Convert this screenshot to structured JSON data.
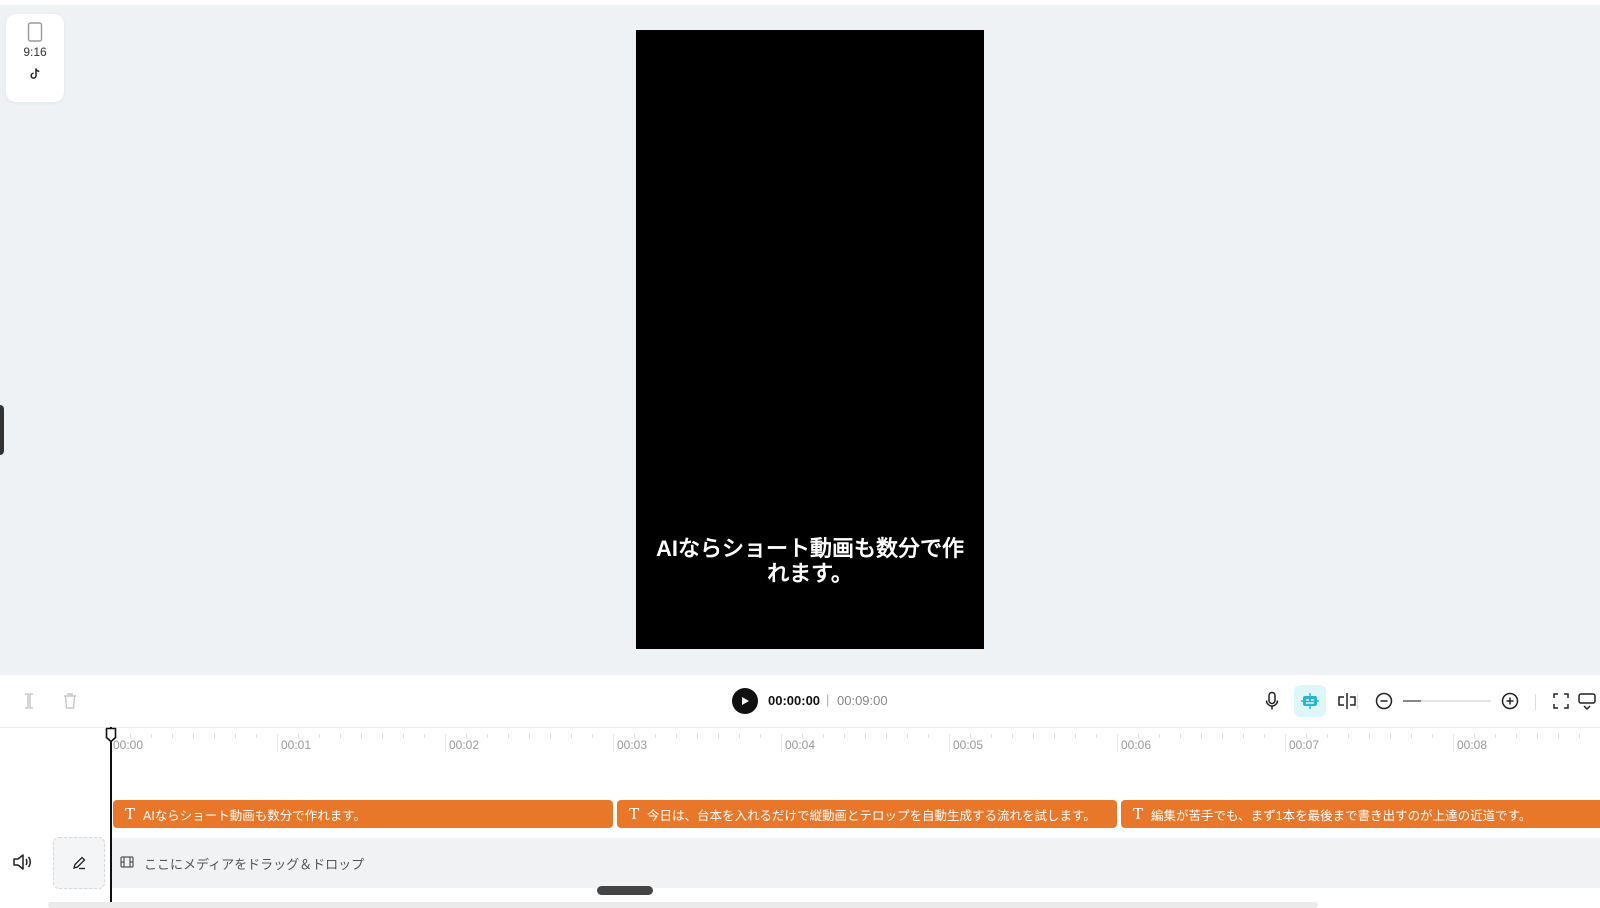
{
  "aspect": {
    "ratio_label": "9:16"
  },
  "preview": {
    "caption": "AIならショート動画も数分で作れます。"
  },
  "player": {
    "current_time": "00:00:00",
    "separator": "|",
    "total_time": "00:09:00",
    "zoom_level": 0.2
  },
  "ruler": {
    "labels": [
      "00:00",
      "00:01",
      "00:02",
      "00:03",
      "00:04",
      "00:05",
      "00:06",
      "00:07",
      "00:08"
    ]
  },
  "text_track": {
    "clips": [
      {
        "text": "AIならショート動画も数分で作れます。"
      },
      {
        "text": "今日は、台本を入れるだけで縦動画とテロップを自動生成する流れを試します。"
      },
      {
        "text": "編集が苦手でも、まず1本を最後まで書き出すのが上達の近道です。"
      }
    ]
  },
  "media_track": {
    "hint": "ここにメディアをドラッグ＆ドロップ"
  },
  "colors": {
    "clip": "#e8772a",
    "accent": "#2bb5c8",
    "preview_bg": "#000000"
  }
}
